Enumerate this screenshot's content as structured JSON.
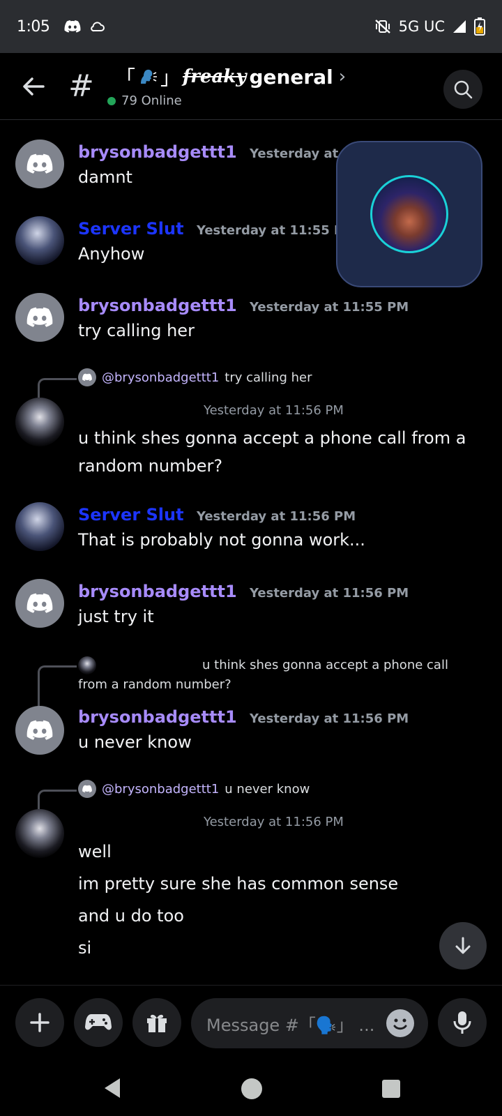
{
  "status_bar": {
    "time": "1:05",
    "network": "5G UC",
    "icons": [
      "discord-icon",
      "cloud-icon",
      "mute-vibrate-icon",
      "signal-icon",
      "battery-charging-icon"
    ]
  },
  "header": {
    "channel_prefix": "「",
    "channel_suffix": "」",
    "channel_freaky": "freaky",
    "channel_name": "general",
    "online_text": "79 Online"
  },
  "messages": [
    {
      "author": "brysonbadgettt1",
      "timestamp": "Yesterday at 11:55 PM",
      "lines": [
        "damnt"
      ],
      "avatar": "discord-default"
    },
    {
      "author": "Server Slut",
      "timestamp": "Yesterday at 11:55 PM",
      "lines": [
        "Anyhow"
      ],
      "avatar": "anime"
    },
    {
      "author": "brysonbadgettt1",
      "timestamp": "Yesterday at 11:55 PM",
      "lines": [
        "try calling her"
      ],
      "avatar": "discord-default"
    },
    {
      "reply_to": {
        "mention": "@brysonbadgettt1",
        "text": "try calling her"
      },
      "author": "",
      "timestamp": "Yesterday at 11:56 PM",
      "lines": [
        "u think shes gonna accept a phone call from  a",
        "random number?"
      ],
      "avatar": "robot"
    },
    {
      "author": "Server Slut",
      "timestamp": "Yesterday at 11:56 PM",
      "lines": [
        "That is probably not gonna work..."
      ],
      "avatar": "anime"
    },
    {
      "author": "brysonbadgettt1",
      "timestamp": "Yesterday at 11:56 PM",
      "lines": [
        "just try it"
      ],
      "avatar": "discord-default"
    },
    {
      "reply_to": {
        "mention": "",
        "text_line1": "u think shes gonna accept a phone call",
        "text_line2": "from  a random number?"
      },
      "author": "brysonbadgettt1",
      "timestamp": "Yesterday at 11:56 PM",
      "lines": [
        "u never know"
      ],
      "avatar": "discord-default"
    },
    {
      "reply_to": {
        "mention": "@brysonbadgettt1",
        "text": "u never know"
      },
      "author": "",
      "timestamp": "Yesterday at 11:56 PM",
      "lines": [
        "well",
        "im pretty sure she has common sense",
        "and u do too",
        "si"
      ],
      "avatar": "robot"
    }
  ],
  "composer": {
    "placeholder": "Message #「🗣️」 ..."
  },
  "colors": {
    "role_purple": "#a78bfa",
    "role_blue": "#1c35ff",
    "online_green": "#23a559"
  }
}
